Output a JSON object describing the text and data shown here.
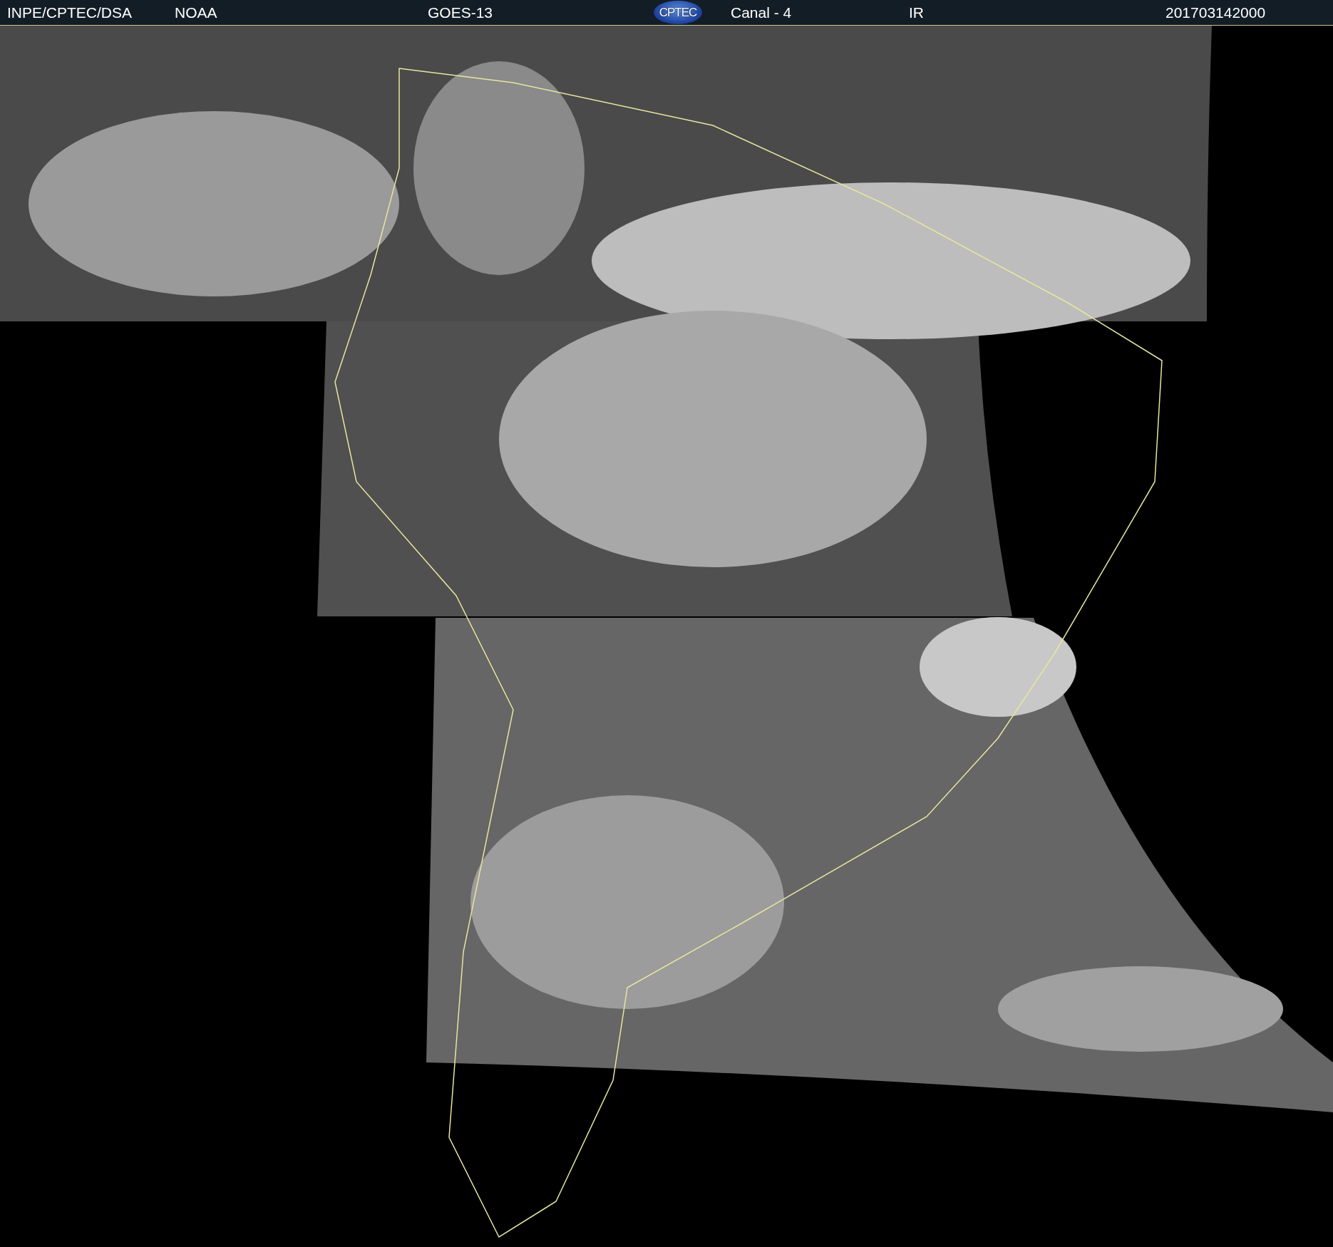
{
  "header": {
    "items": [
      {
        "kind": "text",
        "text": "INPE/CPTEC/DSA"
      },
      {
        "kind": "text",
        "text": "NOAA"
      },
      {
        "kind": "text",
        "text": "GOES-13"
      },
      {
        "kind": "logo",
        "text": "CPTEC"
      },
      {
        "kind": "text",
        "text": "Canal - 4"
      },
      {
        "kind": "text",
        "text": "IR"
      },
      {
        "kind": "text",
        "text": "201703142000"
      }
    ]
  }
}
